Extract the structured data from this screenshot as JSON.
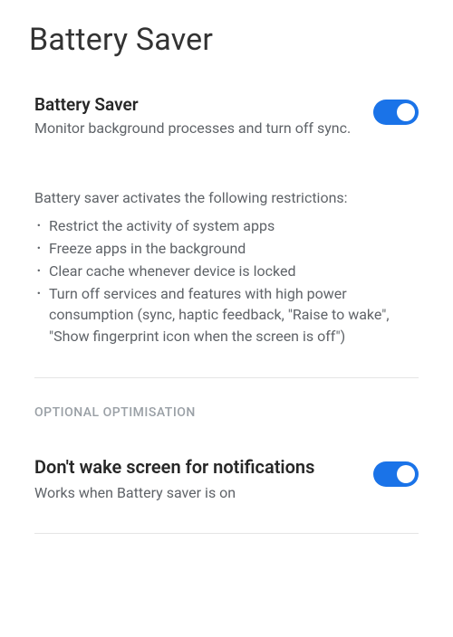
{
  "header": {
    "title": "Battery Saver"
  },
  "main": {
    "settings": [
      {
        "title": "Battery Saver",
        "description": "Monitor background processes and turn off sync.",
        "enabled": true
      }
    ],
    "restrictions": {
      "intro": "Battery saver activates the following restrictions:",
      "items": [
        "Restrict the activity of system apps",
        "Freeze apps in the background",
        "Clear cache whenever device is locked",
        "Turn off services and features with high power consumption (sync, haptic feedback, \"Raise to wake\", \"Show fingerprint icon when the screen is off\")"
      ]
    }
  },
  "optional": {
    "header": "OPTIONAL OPTIMISATION",
    "settings": [
      {
        "title": "Don't wake screen for notifications",
        "description": "Works when Battery saver is on",
        "enabled": true
      }
    ]
  },
  "colors": {
    "accent": "#1a73e8"
  }
}
